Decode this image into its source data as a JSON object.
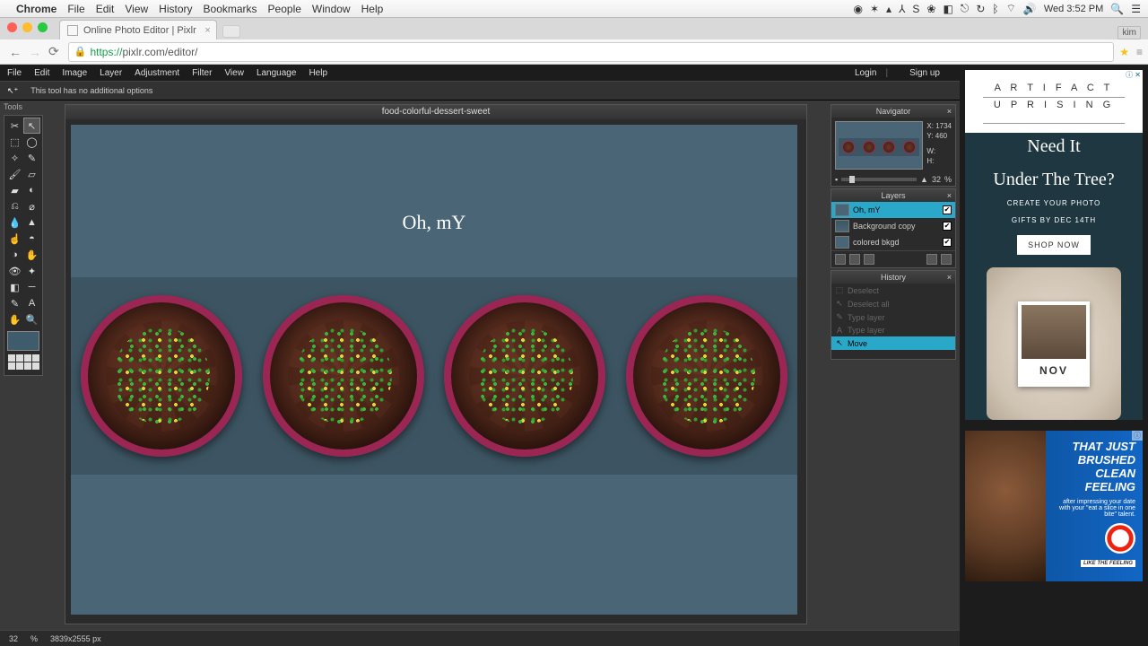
{
  "macos": {
    "app": "Chrome",
    "menus": [
      "File",
      "Edit",
      "View",
      "History",
      "Bookmarks",
      "People",
      "Window",
      "Help"
    ],
    "clock": "Wed 3:52 PM"
  },
  "browser": {
    "tab_title": "Online Photo Editor | Pixlr",
    "url_scheme": "https://",
    "url_rest": "pixlr.com/editor/",
    "user_badge": "kim",
    "traffic": {
      "close": "#ff5f57",
      "min": "#febc2e",
      "max": "#28c840"
    }
  },
  "pixlr": {
    "menus": [
      "File",
      "Edit",
      "Image",
      "Layer",
      "Adjustment",
      "Filter",
      "View",
      "Language",
      "Help"
    ],
    "auth": {
      "login": "Login",
      "signup": "Sign up"
    },
    "options_msg": "This tool has no additional options",
    "tools_label": "Tools",
    "canvas_title": "food-colorful-dessert-sweet",
    "canvas_text": "Oh, mY",
    "status": {
      "zoom": "32",
      "pct": "%",
      "dims": "3839x2555 px"
    }
  },
  "navigator": {
    "title": "Navigator",
    "coords": {
      "x_label": "X:",
      "x": "1734",
      "y_label": "Y:",
      "y": "460",
      "w_label": "W:",
      "h_label": "H:"
    },
    "zoom": "32",
    "pct": "%"
  },
  "layers": {
    "title": "Layers",
    "items": [
      {
        "name": "Oh, mY",
        "selected": true
      },
      {
        "name": "Background copy",
        "selected": false
      },
      {
        "name": "colored bkgd",
        "selected": false
      }
    ]
  },
  "history": {
    "title": "History",
    "items": [
      {
        "name": "Deselect",
        "icon": "⬚"
      },
      {
        "name": "Deselect all",
        "icon": "↖"
      },
      {
        "name": "Type layer",
        "icon": "✎"
      },
      {
        "name": "Type layer",
        "icon": "A"
      },
      {
        "name": "Move",
        "icon": "↖",
        "selected": true
      }
    ]
  },
  "ads": {
    "ad1": {
      "brand_top": "A R T I F A C T",
      "brand_bottom": "U P R I S I N G",
      "headline1": "Need It",
      "headline2": "Under The Tree?",
      "sub1": "CREATE YOUR PHOTO",
      "sub2": "GIFTS BY DEC 14TH",
      "cta": "SHOP NOW",
      "polaroid_caption": "NOV"
    },
    "ad2": {
      "line1": "THAT JUST",
      "line2": "BRUSHED",
      "line3": "CLEAN",
      "line4": "FEELING",
      "small": "after impressing your date with your \"eat a slice in one bite\" talent.",
      "brand": "Orbit",
      "like": "LIKE THE FEELING"
    }
  }
}
